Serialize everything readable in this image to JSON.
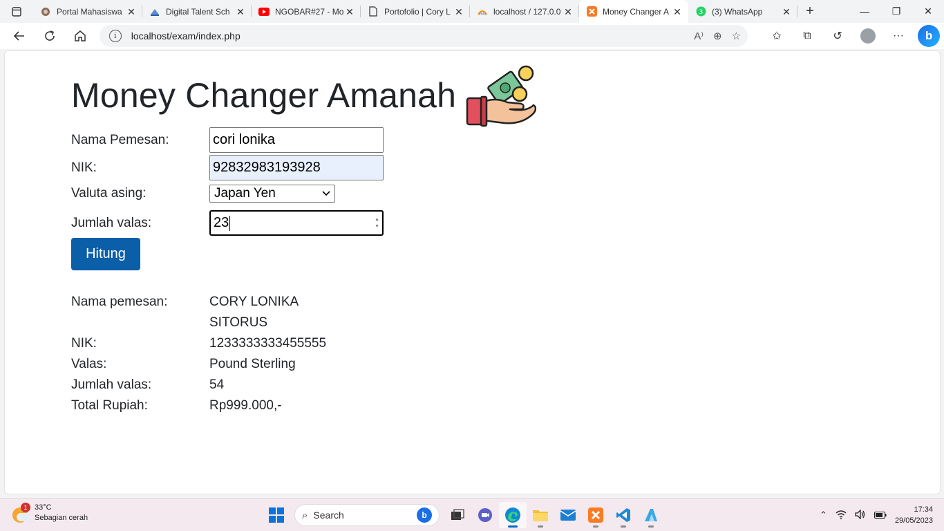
{
  "browser": {
    "tabs": [
      {
        "title": "Portal Mahasiswa",
        "icon": "university-icon"
      },
      {
        "title": "Digital Talent Sch",
        "icon": "dts-icon"
      },
      {
        "title": "NGOBAR#27 - Mo",
        "icon": "youtube-icon"
      },
      {
        "title": "Portofolio | Cory L",
        "icon": "page-icon"
      },
      {
        "title": "localhost / 127.0.0",
        "icon": "phpmyadmin-icon"
      },
      {
        "title": "Money Changer A",
        "icon": "xampp-icon",
        "active": true
      },
      {
        "title": "(3) WhatsApp",
        "icon": "whatsapp-icon"
      }
    ],
    "url": "localhost/exam/index.php"
  },
  "page": {
    "title": "Money Changer Amanah",
    "form": {
      "nama_label": "Nama Pemesan:",
      "nama_value": "cori lonika",
      "nik_label": "NIK:",
      "nik_value": "92832983193928",
      "valuta_label": "Valuta asing:",
      "valuta_selected": "Japan Yen",
      "jumlah_label": "Jumlah valas:",
      "jumlah_value": "23",
      "submit_label": "Hitung"
    },
    "result": {
      "nama_label": "Nama pemesan:",
      "nama_value": "CORY LONIKA SITORUS",
      "nik_label": "NIK:",
      "nik_value": "1233333333455555",
      "valas_label": "Valas:",
      "valas_value": "Pound Sterling",
      "jumlah_label": "Jumlah valas:",
      "jumlah_value": "54",
      "total_label": "Total Rupiah:",
      "total_value": "Rp999.000,-"
    }
  },
  "taskbar": {
    "weather_temp": "33°C",
    "weather_desc": "Sebagian cerah",
    "weather_badge": "1",
    "search_placeholder": "Search",
    "time": "17:34",
    "date": "29/05/2023"
  },
  "colors": {
    "button": "#0b5ea8",
    "autofill": "#e8f0fe",
    "text": "#212529"
  }
}
